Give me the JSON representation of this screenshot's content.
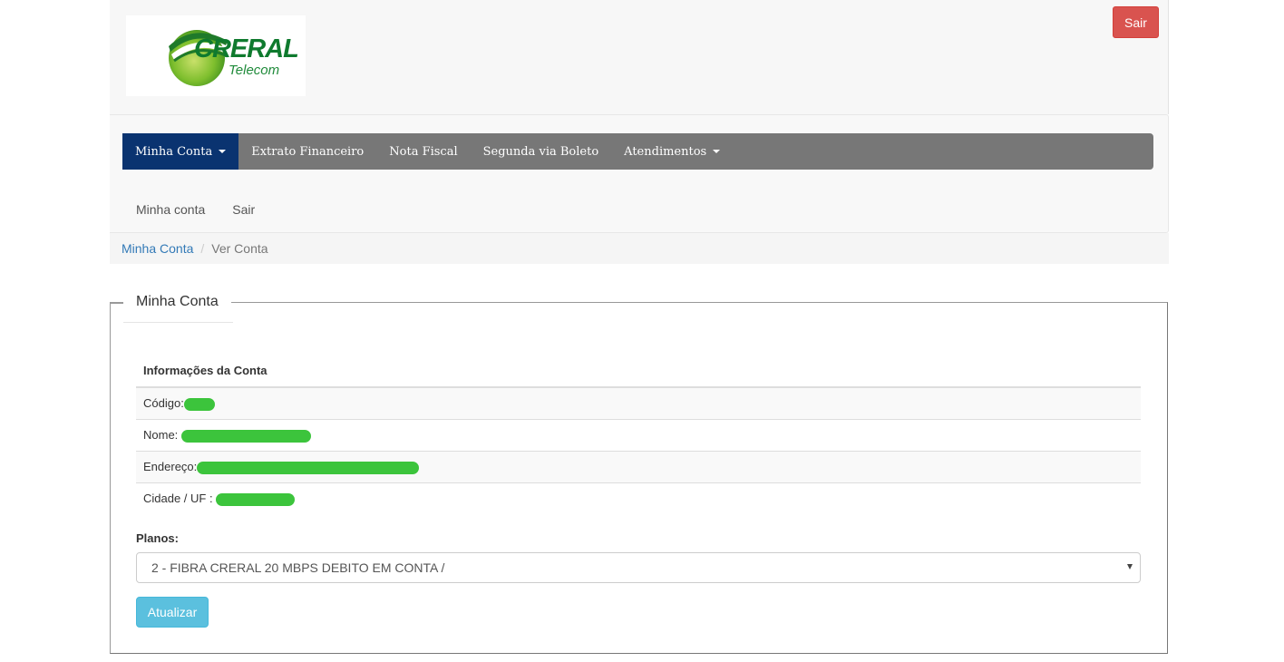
{
  "header": {
    "logo_title": "CRERAL",
    "logo_subtitle": "Telecom",
    "logout_button": "Sair"
  },
  "navbar": {
    "items": [
      {
        "label": "Minha Conta",
        "active": true,
        "dropdown": true
      },
      {
        "label": "Extrato Financeiro",
        "active": false,
        "dropdown": false
      },
      {
        "label": "Nota Fiscal",
        "active": false,
        "dropdown": false
      },
      {
        "label": "Segunda via Boleto",
        "active": false,
        "dropdown": false
      },
      {
        "label": "Atendimentos",
        "active": false,
        "dropdown": true
      }
    ]
  },
  "subnav": {
    "items": [
      {
        "label": "Minha conta"
      },
      {
        "label": "Sair"
      }
    ]
  },
  "breadcrumb": {
    "link": "Minha Conta",
    "separator": "/",
    "current": "Ver Conta"
  },
  "section": {
    "legend": "Minha Conta",
    "table_header": "Informações da Conta",
    "rows": [
      {
        "label": "Código:"
      },
      {
        "label": "Nome: "
      },
      {
        "label": "Endereço:"
      },
      {
        "label": "Cidade / UF :"
      }
    ],
    "planos_label": "Planos:",
    "plan_selected": "2 - FIBRA CRERAL 20 MBPS DEBITO EM CONTA /",
    "update_button": "Atualizar"
  },
  "colors": {
    "active_nav": "#0a3370",
    "navbar_bg": "#777777",
    "logout_button": "#d9534f",
    "update_button": "#5bc0de",
    "redaction": "#3cc43c"
  }
}
